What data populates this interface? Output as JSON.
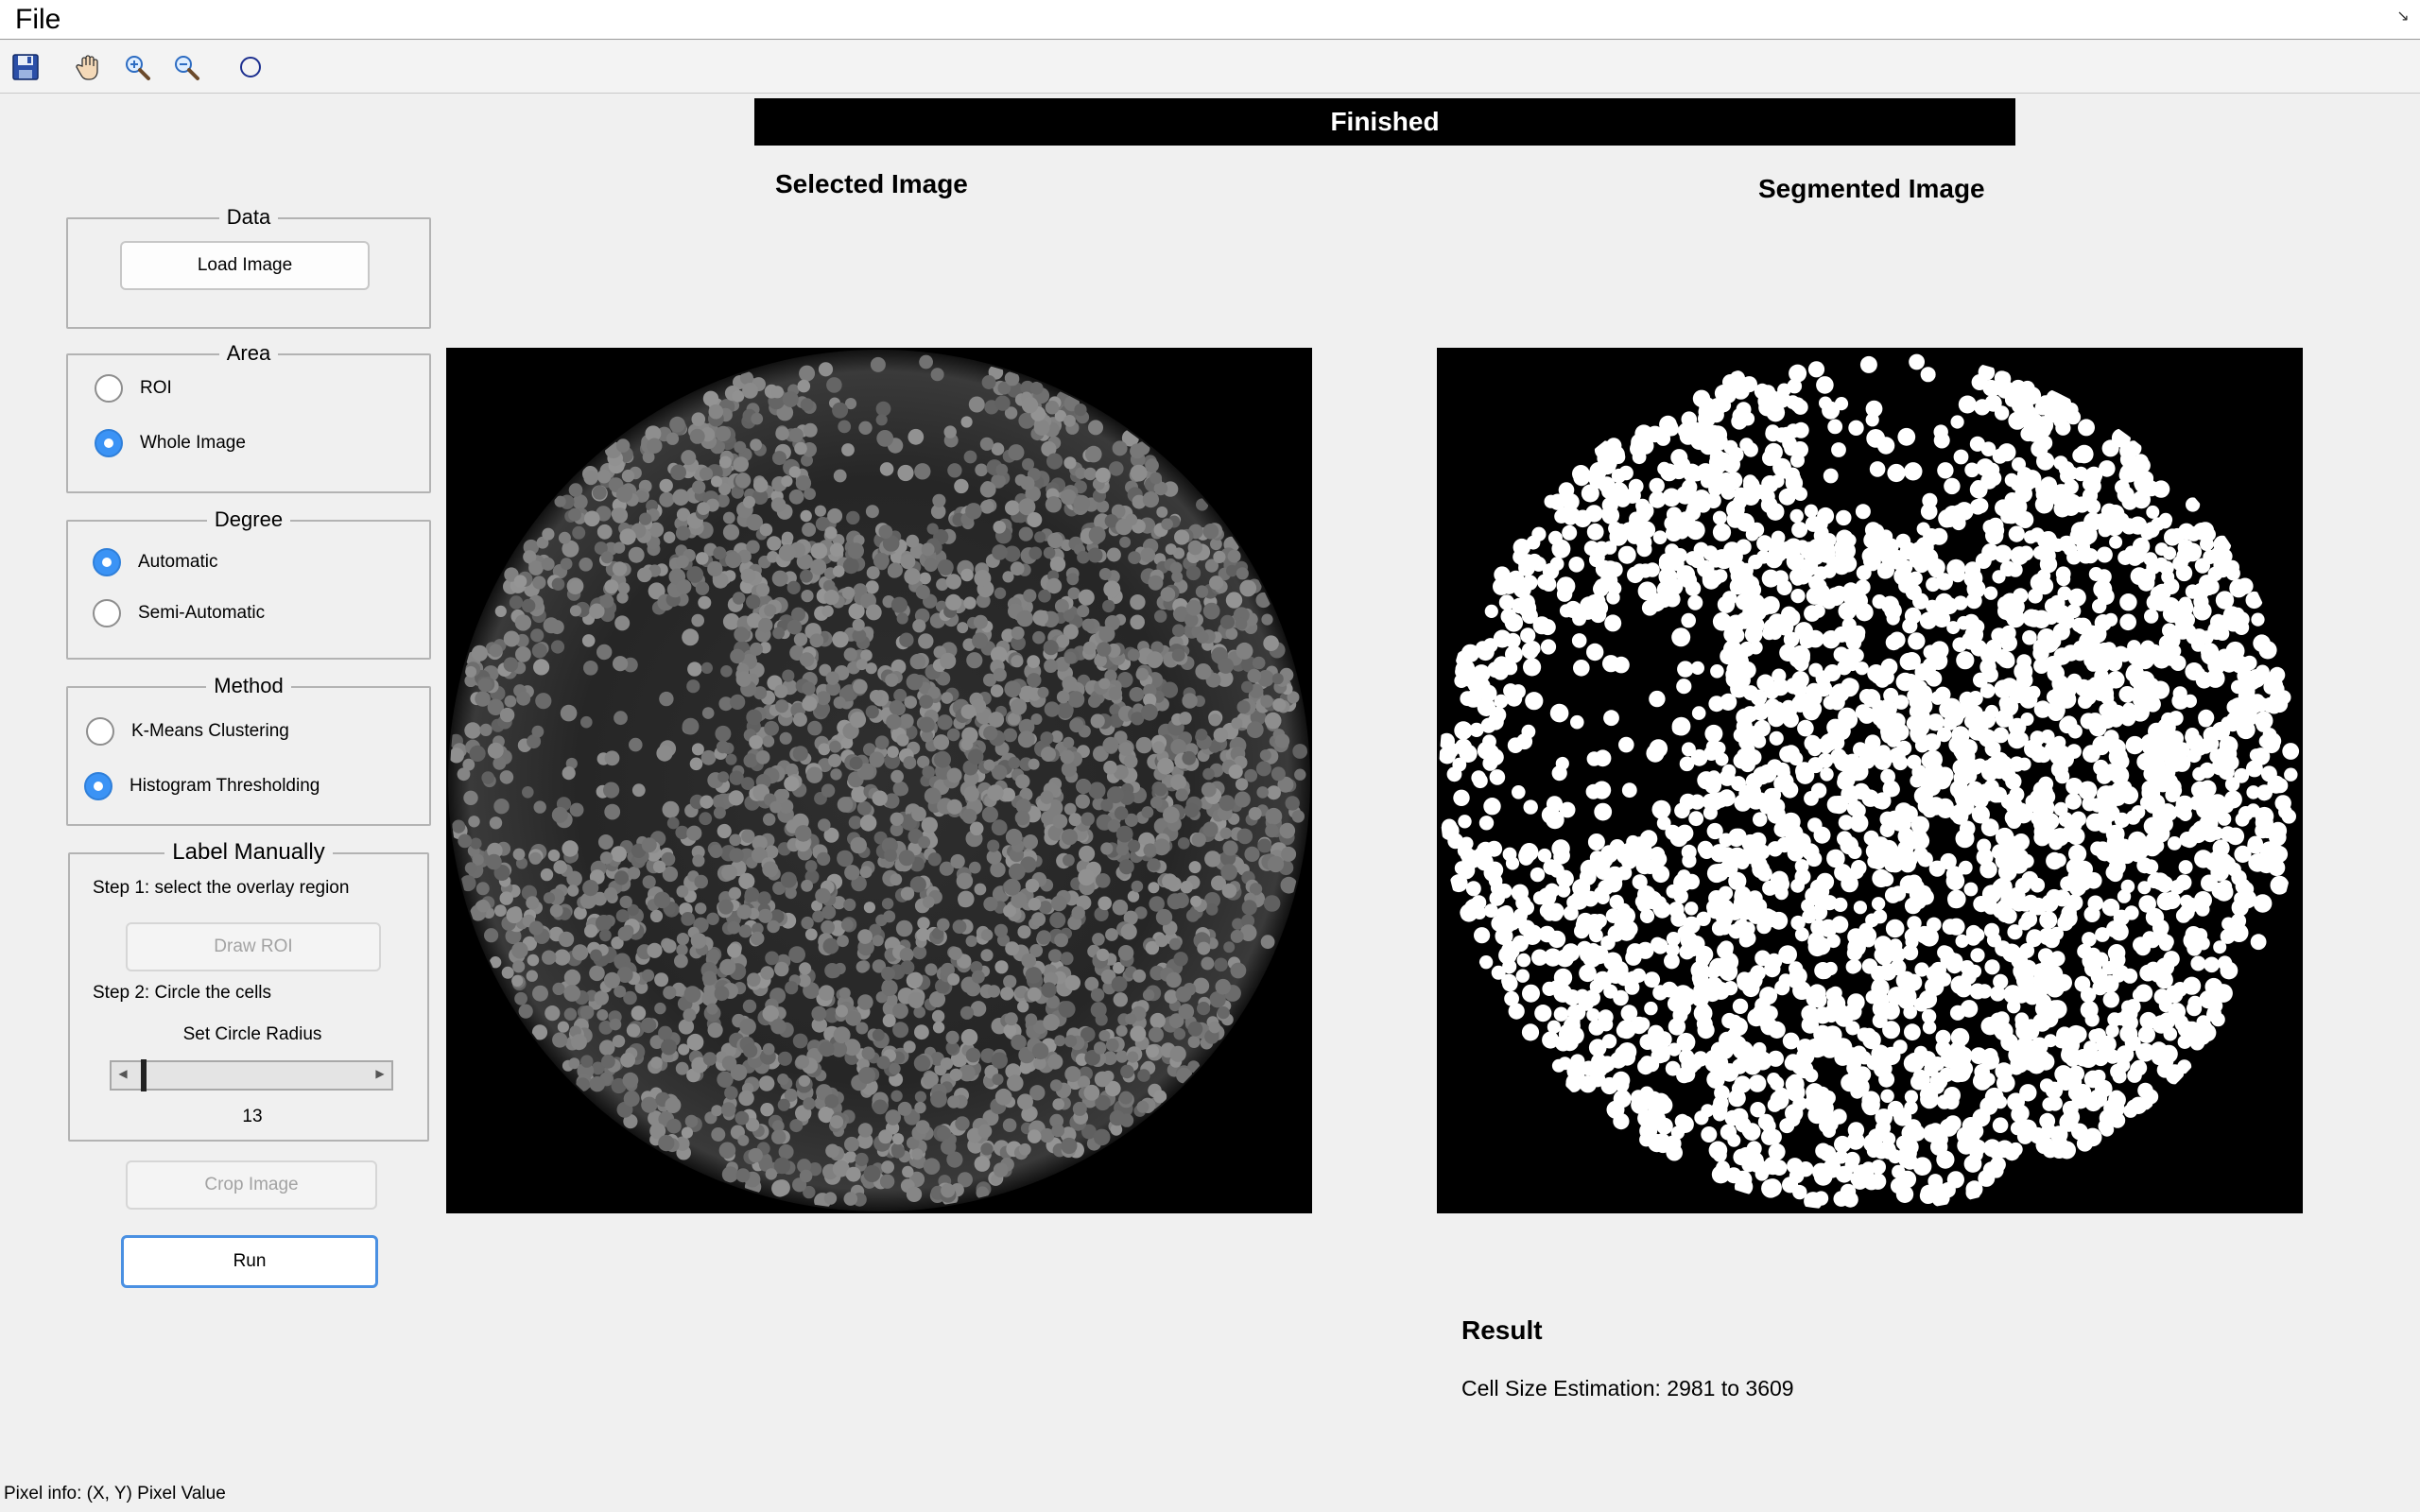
{
  "menubar": {
    "file_label": "File"
  },
  "toolbar": {
    "tools": [
      {
        "name": "save-icon"
      },
      {
        "name": "pan-hand-icon"
      },
      {
        "name": "zoom-in-icon"
      },
      {
        "name": "zoom-out-icon"
      },
      {
        "name": "circle-icon"
      }
    ]
  },
  "status": {
    "text": "Finished"
  },
  "panels": {
    "selected_title": "Selected Image",
    "segmented_title": "Segmented Image"
  },
  "data_group": {
    "title": "Data",
    "load_button": "Load Image"
  },
  "area_group": {
    "title": "Area",
    "options": [
      {
        "label": "ROI",
        "checked": false
      },
      {
        "label": "Whole Image",
        "checked": true
      }
    ]
  },
  "degree_group": {
    "title": "Degree",
    "options": [
      {
        "label": "Automatic",
        "checked": true
      },
      {
        "label": "Semi-Automatic",
        "checked": false
      }
    ]
  },
  "method_group": {
    "title": "Method",
    "options": [
      {
        "label": "K-Means Clustering",
        "checked": false
      },
      {
        "label": "Histogram Thresholding",
        "checked": true
      }
    ]
  },
  "label_group": {
    "title": "Label Manually",
    "step1": "Step 1: select the overlay region",
    "draw_roi_button": "Draw ROI",
    "step2": "Step 2: Circle the cells",
    "radius_label": "Set Circle Radius",
    "radius_value": "13",
    "radius_slider_fraction": 0.02
  },
  "actions": {
    "crop_button": "Crop Image",
    "run_button": "Run"
  },
  "result": {
    "title": "Result",
    "text": "Cell Size Estimation: 2981 to 3609"
  },
  "footer": {
    "pixel_info": "Pixel info: (X, Y)  Pixel Value"
  },
  "colors": {
    "accent": "#3b93f5",
    "background": "#f0f0f0"
  }
}
